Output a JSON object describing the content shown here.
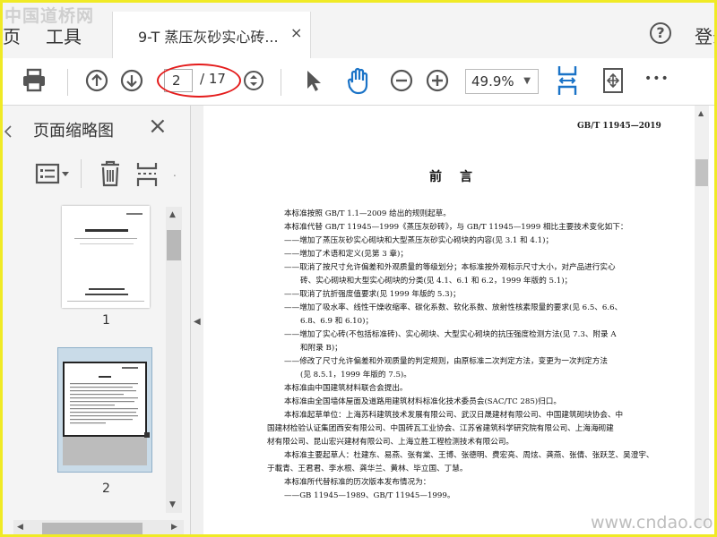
{
  "watermark_top": "中国道桥网",
  "watermark_bottom": "www.cndao.com",
  "tabs": {
    "home_label": "页",
    "tools_label": "工具",
    "document_title": "9-T 蒸压灰砂实心砖...",
    "close_symbol": "×",
    "help_symbol": "?",
    "login_label": "登录"
  },
  "toolbar": {
    "page_current": "2",
    "page_total": "/ 17",
    "zoom": "49.9%",
    "more_symbol": "•••",
    "icons": [
      "print-icon",
      "prev-page-icon",
      "next-page-icon",
      "page-nav-icon",
      "select-arrow-icon",
      "hand-tool-icon",
      "zoom-out-icon",
      "zoom-in-icon",
      "fit-page-icon",
      "fit-width-icon",
      "more-icon"
    ],
    "accent_color": "#1a73c7",
    "highlight_color": "#e41b1b"
  },
  "sidebar": {
    "title": "页面缩略图",
    "close_symbol": "×",
    "thumbnails": [
      {
        "label": "1"
      },
      {
        "label": "2",
        "selected": true
      }
    ]
  },
  "document": {
    "standard_no": "GB/T 11945—2019",
    "heading": "前言",
    "lines": [
      "本标准按照 GB/T 1.1—2009 给出的规则起草。",
      "本标准代替 GB/T 11945—1999《蒸压灰砂砖》，与 GB/T 11945—1999 相比主要技术变化如下：",
      "——增加了蒸压灰砂实心砌块和大型蒸压灰砂实心砌块的内容(见 3.1 和 4.1)；",
      "——增加了术语和定义(见第 3 章)；",
      "——取消了按尺寸允许偏差和外观质量的等级划分；本标准按外观标示尺寸大小，对产品进行实心",
      "砖、实心砌块和大型实心砌块的分类(见 4.1、6.1 和 6.2，1999 年版的 5.1)；",
      "——取消了抗折强度值要求(见 1999 年版的 5.3)；",
      "——增加了吸水率、线性干燥收缩率、碳化系数、软化系数、放射性核素限量的要求(见 6.5、6.6、",
      "6.8、6.9 和 6.10)；",
      "——增加了实心砖(不包括标准砖)、实心砌块、大型实心砌块的抗压强度检测方法(见 7.3、附录 A",
      "和附录 B)；",
      "——修改了尺寸允许偏差和外观质量的判定规则，由原标准二次判定方法，变更为一次判定方法",
      "(见 8.5.1，1999 年版的 7.5)。",
      "本标准由中国建筑材料联合会提出。",
      "本标准由全国墙体屋面及道路用建筑材料标准化技术委员会(SAC/TC 285)归口。",
      "本标准起草单位：上海苏科建筑技术发展有限公司、武汉日晟建材有限公司、中国建筑砌块协会、中",
      "国建材检验认证集团西安有限公司、中国砖瓦工业协会、江苏省建筑科学研究院有限公司、上海海砌建",
      "材有限公司、昆山宏兴建材有限公司、上海立胜工程检测技术有限公司。",
      "本标准主要起草人：杜建东、易燕、张有棠、王博、张德明、费宏亮、周炫、龚燕、张倩、张跃芝、吴澄宇、",
      "于載青、王君君、李水根、龚华兰、黄林、毕立国、丁慧。",
      "本标准所代替标准的历次版本发布情况为：",
      "——GB 11945—1989、GB/T 11945—1999。"
    ]
  }
}
